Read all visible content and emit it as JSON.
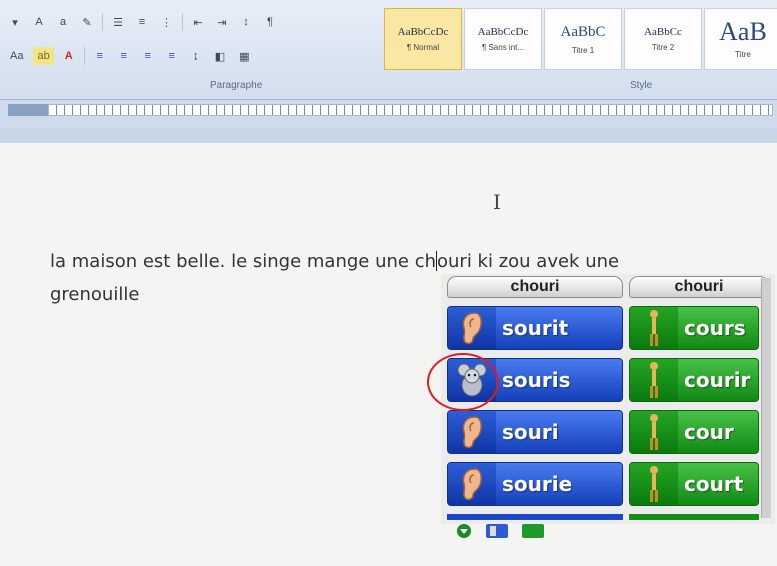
{
  "ribbon": {
    "paragraph_group": "Paragraphe",
    "style_group": "Style",
    "styles": [
      {
        "preview": "AaBbCcDc",
        "name": "¶ Normal",
        "active": true
      },
      {
        "preview": "AaBbCcDc",
        "name": "¶ Sans int...",
        "active": false
      },
      {
        "preview": "AaBbC",
        "name": "Titre 1",
        "active": false
      },
      {
        "preview": "AaBbCc",
        "name": "Titre 2",
        "active": false
      },
      {
        "preview": "AaB",
        "name": "Titre",
        "active": false
      }
    ]
  },
  "document": {
    "line1_before_caret": "la maison est belle. le singe mange une ch",
    "line1_after_caret": "ouri ki zou avek une",
    "line2": "grenouille"
  },
  "prediction": {
    "left_header": "chouri",
    "right_header": "chouri",
    "left_words": [
      "sourit",
      "souris",
      "souri",
      "sourie"
    ],
    "right_words": [
      "cours",
      "courir",
      "cour",
      "court"
    ],
    "left_icons": [
      "ear-icon",
      "mouse-icon",
      "ear-icon",
      "ear-icon"
    ],
    "right_icon": "running-figure-icon",
    "colors": {
      "blue": "#1b48c6",
      "green": "#14901a",
      "highlight_circle": "#e21b1b"
    }
  }
}
